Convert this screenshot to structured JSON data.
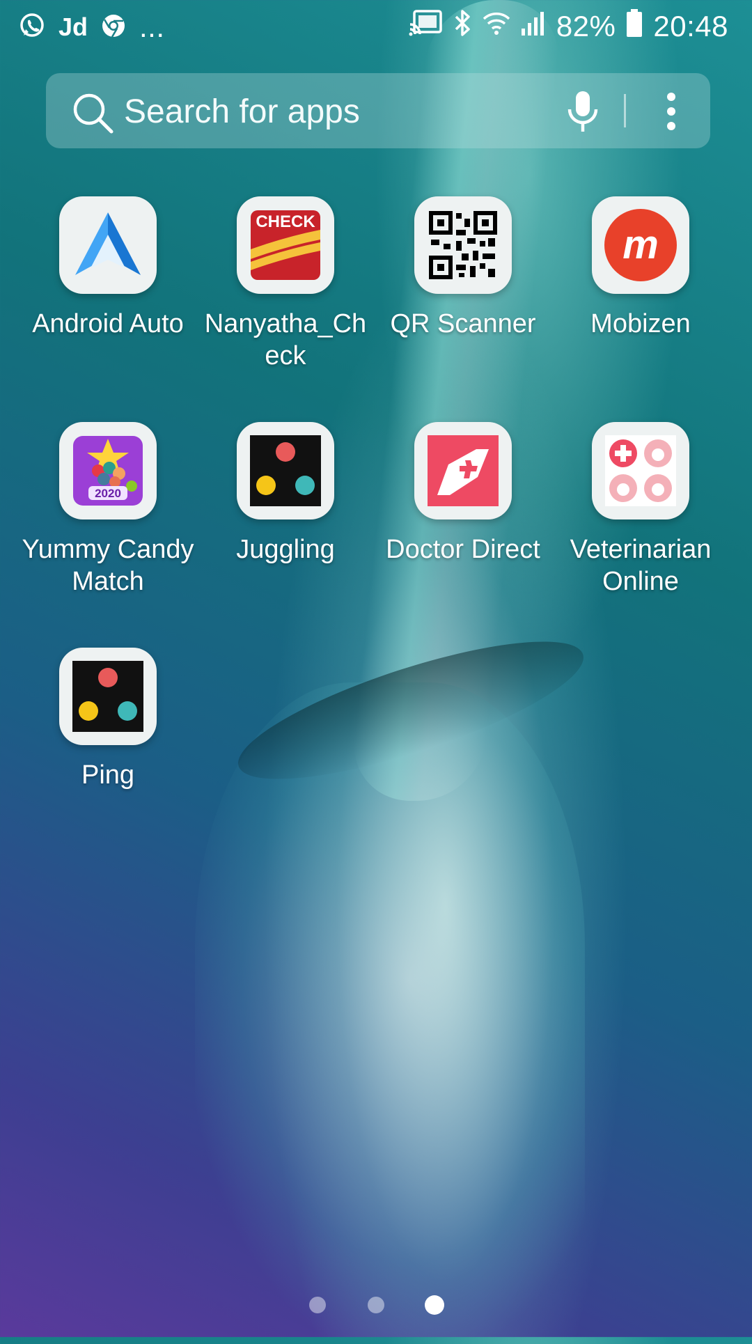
{
  "status_bar": {
    "left_icons": [
      "whatsapp-icon",
      "jd-icon",
      "chrome-icon",
      "more-notifications-icon"
    ],
    "jd_text": "Jd",
    "more_text": "...",
    "right_icons": [
      "cast-icon",
      "bluetooth-icon",
      "wifi-icon",
      "signal-icon",
      "battery-icon"
    ],
    "battery": "82%",
    "time": "20:48"
  },
  "search": {
    "placeholder": "Search for apps",
    "icons": [
      "search-icon",
      "mic-icon",
      "more-vert-icon"
    ]
  },
  "apps": [
    {
      "label": "Android Auto",
      "icon": "android-auto-icon"
    },
    {
      "label": "Nanyatha_Check",
      "label_line1": "Nanyatha_Ch",
      "label_line2": "eck",
      "icon": "check-icon",
      "icon_text": "CHECK"
    },
    {
      "label": "QR Scanner",
      "icon": "qr-code-icon"
    },
    {
      "label": "Mobizen",
      "icon": "mobizen-icon",
      "icon_text": "m"
    },
    {
      "label": "Yummy Candy Match",
      "label_line1": "Yummy Candy",
      "label_line2": "Match",
      "icon": "candy-icon",
      "icon_text": "2020"
    },
    {
      "label": "Juggling",
      "icon": "juggling-balls-icon"
    },
    {
      "label": "Doctor Direct",
      "icon": "doctor-direct-icon"
    },
    {
      "label": "Veterinarian Online",
      "label_line1": "Veterinarian",
      "label_line2": "Online",
      "icon": "veterinarian-icon"
    },
    {
      "label": "Ping",
      "icon": "juggling-balls-icon"
    }
  ],
  "page_indicator": {
    "pages": 3,
    "current": 3
  },
  "colors": {
    "mobizen": "#e8412a",
    "check_red": "#c8232a",
    "check_yellow": "#f5c23b",
    "doctor": "#ee4a63",
    "vet_pink": "#f08a98",
    "android_auto_blue": "#2196f3"
  }
}
